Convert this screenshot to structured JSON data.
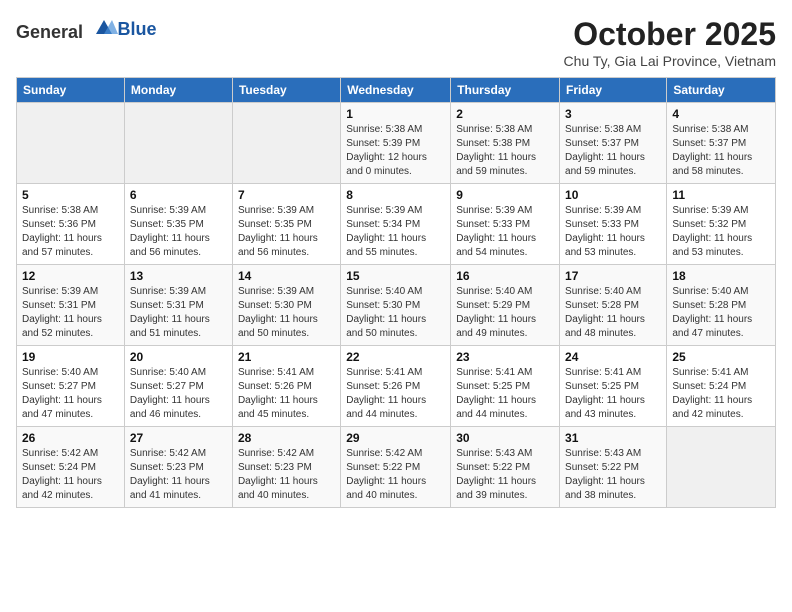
{
  "header": {
    "logo_general": "General",
    "logo_blue": "Blue",
    "month": "October 2025",
    "location": "Chu Ty, Gia Lai Province, Vietnam"
  },
  "weekdays": [
    "Sunday",
    "Monday",
    "Tuesday",
    "Wednesday",
    "Thursday",
    "Friday",
    "Saturday"
  ],
  "weeks": [
    [
      {
        "day": "",
        "info": ""
      },
      {
        "day": "",
        "info": ""
      },
      {
        "day": "",
        "info": ""
      },
      {
        "day": "1",
        "info": "Sunrise: 5:38 AM\nSunset: 5:39 PM\nDaylight: 12 hours\nand 0 minutes."
      },
      {
        "day": "2",
        "info": "Sunrise: 5:38 AM\nSunset: 5:38 PM\nDaylight: 11 hours\nand 59 minutes."
      },
      {
        "day": "3",
        "info": "Sunrise: 5:38 AM\nSunset: 5:37 PM\nDaylight: 11 hours\nand 59 minutes."
      },
      {
        "day": "4",
        "info": "Sunrise: 5:38 AM\nSunset: 5:37 PM\nDaylight: 11 hours\nand 58 minutes."
      }
    ],
    [
      {
        "day": "5",
        "info": "Sunrise: 5:38 AM\nSunset: 5:36 PM\nDaylight: 11 hours\nand 57 minutes."
      },
      {
        "day": "6",
        "info": "Sunrise: 5:39 AM\nSunset: 5:35 PM\nDaylight: 11 hours\nand 56 minutes."
      },
      {
        "day": "7",
        "info": "Sunrise: 5:39 AM\nSunset: 5:35 PM\nDaylight: 11 hours\nand 56 minutes."
      },
      {
        "day": "8",
        "info": "Sunrise: 5:39 AM\nSunset: 5:34 PM\nDaylight: 11 hours\nand 55 minutes."
      },
      {
        "day": "9",
        "info": "Sunrise: 5:39 AM\nSunset: 5:33 PM\nDaylight: 11 hours\nand 54 minutes."
      },
      {
        "day": "10",
        "info": "Sunrise: 5:39 AM\nSunset: 5:33 PM\nDaylight: 11 hours\nand 53 minutes."
      },
      {
        "day": "11",
        "info": "Sunrise: 5:39 AM\nSunset: 5:32 PM\nDaylight: 11 hours\nand 53 minutes."
      }
    ],
    [
      {
        "day": "12",
        "info": "Sunrise: 5:39 AM\nSunset: 5:31 PM\nDaylight: 11 hours\nand 52 minutes."
      },
      {
        "day": "13",
        "info": "Sunrise: 5:39 AM\nSunset: 5:31 PM\nDaylight: 11 hours\nand 51 minutes."
      },
      {
        "day": "14",
        "info": "Sunrise: 5:39 AM\nSunset: 5:30 PM\nDaylight: 11 hours\nand 50 minutes."
      },
      {
        "day": "15",
        "info": "Sunrise: 5:40 AM\nSunset: 5:30 PM\nDaylight: 11 hours\nand 50 minutes."
      },
      {
        "day": "16",
        "info": "Sunrise: 5:40 AM\nSunset: 5:29 PM\nDaylight: 11 hours\nand 49 minutes."
      },
      {
        "day": "17",
        "info": "Sunrise: 5:40 AM\nSunset: 5:28 PM\nDaylight: 11 hours\nand 48 minutes."
      },
      {
        "day": "18",
        "info": "Sunrise: 5:40 AM\nSunset: 5:28 PM\nDaylight: 11 hours\nand 47 minutes."
      }
    ],
    [
      {
        "day": "19",
        "info": "Sunrise: 5:40 AM\nSunset: 5:27 PM\nDaylight: 11 hours\nand 47 minutes."
      },
      {
        "day": "20",
        "info": "Sunrise: 5:40 AM\nSunset: 5:27 PM\nDaylight: 11 hours\nand 46 minutes."
      },
      {
        "day": "21",
        "info": "Sunrise: 5:41 AM\nSunset: 5:26 PM\nDaylight: 11 hours\nand 45 minutes."
      },
      {
        "day": "22",
        "info": "Sunrise: 5:41 AM\nSunset: 5:26 PM\nDaylight: 11 hours\nand 44 minutes."
      },
      {
        "day": "23",
        "info": "Sunrise: 5:41 AM\nSunset: 5:25 PM\nDaylight: 11 hours\nand 44 minutes."
      },
      {
        "day": "24",
        "info": "Sunrise: 5:41 AM\nSunset: 5:25 PM\nDaylight: 11 hours\nand 43 minutes."
      },
      {
        "day": "25",
        "info": "Sunrise: 5:41 AM\nSunset: 5:24 PM\nDaylight: 11 hours\nand 42 minutes."
      }
    ],
    [
      {
        "day": "26",
        "info": "Sunrise: 5:42 AM\nSunset: 5:24 PM\nDaylight: 11 hours\nand 42 minutes."
      },
      {
        "day": "27",
        "info": "Sunrise: 5:42 AM\nSunset: 5:23 PM\nDaylight: 11 hours\nand 41 minutes."
      },
      {
        "day": "28",
        "info": "Sunrise: 5:42 AM\nSunset: 5:23 PM\nDaylight: 11 hours\nand 40 minutes."
      },
      {
        "day": "29",
        "info": "Sunrise: 5:42 AM\nSunset: 5:22 PM\nDaylight: 11 hours\nand 40 minutes."
      },
      {
        "day": "30",
        "info": "Sunrise: 5:43 AM\nSunset: 5:22 PM\nDaylight: 11 hours\nand 39 minutes."
      },
      {
        "day": "31",
        "info": "Sunrise: 5:43 AM\nSunset: 5:22 PM\nDaylight: 11 hours\nand 38 minutes."
      },
      {
        "day": "",
        "info": ""
      }
    ]
  ]
}
